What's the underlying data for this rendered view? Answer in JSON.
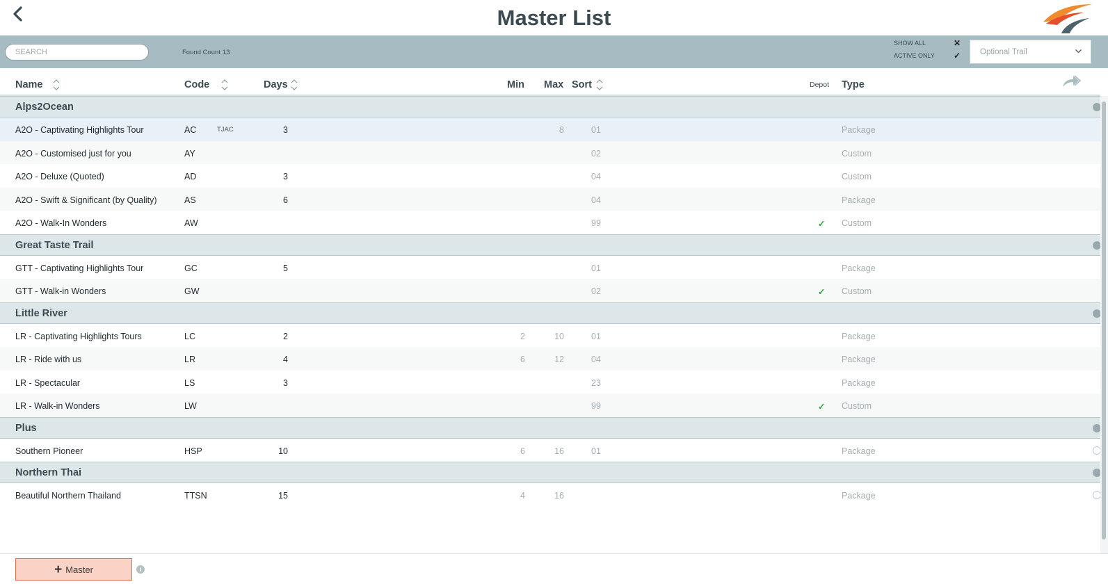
{
  "header": {
    "title": "Master List",
    "back_icon": "chevron-left-icon",
    "logo_icon": "brand-swoosh-logo"
  },
  "toolbar": {
    "search_placeholder": "SEARCH",
    "found_label": "Found Count",
    "found_count": "13",
    "show_all_label": "SHOW ALL",
    "show_all_mark": "✕",
    "active_only_label": "ACTIVE ONLY",
    "active_only_mark": "✓",
    "trail_select_value": "Optional Trail"
  },
  "columns": {
    "name": "Name",
    "code": "Code",
    "days": "Days",
    "min": "Min",
    "max": "Max",
    "sort": "Sort",
    "depot": "Depot",
    "type": "Type"
  },
  "groups": [
    {
      "name": "Alps2Ocean",
      "rows": [
        {
          "name": "A2O - Captivating Highlights Tour",
          "code": "AC",
          "tag": "TJAC",
          "days": "3",
          "min": "",
          "max": "8",
          "sort": "01",
          "depot": "",
          "type": "Package"
        },
        {
          "name": "A2O - Customised just for you",
          "code": "AY",
          "tag": "",
          "days": "",
          "min": "",
          "max": "",
          "sort": "02",
          "depot": "",
          "type": "Custom"
        },
        {
          "name": "A2O - Deluxe (Quoted)",
          "code": "AD",
          "tag": "",
          "days": "3",
          "min": "",
          "max": "",
          "sort": "04",
          "depot": "",
          "type": "Custom"
        },
        {
          "name": "A2O - Swift & Significant (by Quality)",
          "code": "AS",
          "tag": "",
          "days": "6",
          "min": "",
          "max": "",
          "sort": "04",
          "depot": "",
          "type": "Package"
        },
        {
          "name": "A2O - Walk-In Wonders",
          "code": "AW",
          "tag": "",
          "days": "",
          "min": "",
          "max": "",
          "sort": "99",
          "depot": "✓",
          "type": "Custom"
        }
      ]
    },
    {
      "name": "Great Taste Trail",
      "rows": [
        {
          "name": "GTT - Captivating Highlights Tour",
          "code": "GC",
          "tag": "",
          "days": "5",
          "min": "",
          "max": "",
          "sort": "01",
          "depot": "",
          "type": "Package"
        },
        {
          "name": "GTT - Walk-in Wonders",
          "code": "GW",
          "tag": "",
          "days": "",
          "min": "",
          "max": "",
          "sort": "02",
          "depot": "✓",
          "type": "Custom"
        }
      ]
    },
    {
      "name": "Little River",
      "rows": [
        {
          "name": "LR - Captivating Highlights Tours",
          "code": "LC",
          "tag": "",
          "days": "2",
          "min": "2",
          "max": "10",
          "sort": "01",
          "depot": "",
          "type": "Package"
        },
        {
          "name": "LR - Ride with us",
          "code": "LR",
          "tag": "",
          "days": "4",
          "min": "6",
          "max": "12",
          "sort": "04",
          "depot": "",
          "type": "Package"
        },
        {
          "name": "LR - Spectacular",
          "code": "LS",
          "tag": "",
          "days": "3",
          "min": "",
          "max": "",
          "sort": "23",
          "depot": "",
          "type": "Package"
        },
        {
          "name": "LR - Walk-in Wonders",
          "code": "LW",
          "tag": "",
          "days": "",
          "min": "",
          "max": "",
          "sort": "99",
          "depot": "✓",
          "type": "Custom"
        }
      ]
    },
    {
      "name": "Plus",
      "rows": [
        {
          "name": "Southern Pioneer",
          "code": "HSP",
          "tag": "",
          "days": "10",
          "min": "6",
          "max": "16",
          "sort": "01",
          "depot": "",
          "type": "Package"
        }
      ]
    },
    {
      "name": "Northern Thai",
      "rows": [
        {
          "name": "Beautiful Northern Thailand",
          "code": "TTSN",
          "tag": "",
          "days": "15",
          "min": "4",
          "max": "16",
          "sort": "",
          "depot": "",
          "type": "Package"
        }
      ]
    }
  ],
  "footer": {
    "add_label": "Master",
    "info_glyph": "i"
  },
  "colors": {
    "toolbar_bg": "#a6bcc2",
    "group_bg": "#dde7ea",
    "selected_row": "#e9f1f8",
    "depot_check": "#2eaa3f",
    "add_button_bg": "#fbd3c6",
    "add_button_border": "#e46c4f"
  }
}
